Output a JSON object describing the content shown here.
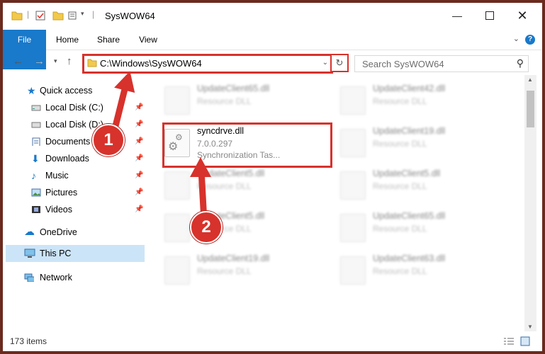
{
  "window": {
    "title": "SysWOW64"
  },
  "ribbon": {
    "tabs": [
      "File",
      "Home",
      "Share",
      "View"
    ],
    "help": "?"
  },
  "address": {
    "path": "C:\\Windows\\SysWOW64",
    "search_placeholder": "Search SysWOW64"
  },
  "nav": {
    "quick_access": "Quick access",
    "items": [
      {
        "label": "Local Disk (C:)",
        "icon": "drive-icon",
        "pinned": true
      },
      {
        "label": "Local Disk (D:)",
        "icon": "drive-icon",
        "pinned": true
      },
      {
        "label": "Documents",
        "icon": "documents-icon",
        "pinned": true
      },
      {
        "label": "Downloads",
        "icon": "download-icon",
        "pinned": true
      },
      {
        "label": "Music",
        "icon": "music-icon",
        "pinned": true
      },
      {
        "label": "Pictures",
        "icon": "pictures-icon",
        "pinned": true
      },
      {
        "label": "Videos",
        "icon": "videos-icon",
        "pinned": true
      }
    ],
    "onedrive": "OneDrive",
    "thispc": "This PC",
    "network": "Network"
  },
  "files": {
    "highlighted": {
      "name": "syncdrve.dll",
      "version": "7.0.0.297",
      "description": "Synchronization Tas..."
    },
    "left": [
      {
        "name": "UpdateClient65.dll",
        "type": "Resource DLL"
      },
      {
        "name": "UpdateClient5.dll",
        "type": "Resource DLL"
      },
      {
        "name": "UpdateClient5.dll",
        "type": "Resource DLL"
      },
      {
        "name": "UpdateClient19.dll",
        "type": "Resource DLL"
      }
    ],
    "right": [
      {
        "name": "UpdateClient42.dll",
        "type": "Resource DLL"
      },
      {
        "name": "UpdateClient19.dll",
        "type": "Resource DLL"
      },
      {
        "name": "UpdateClient5.dll",
        "type": "Resource DLL"
      },
      {
        "name": "UpdateClient65.dll",
        "type": "Resource DLL"
      },
      {
        "name": "UpdateClient63.dll",
        "type": "Resource DLL"
      }
    ]
  },
  "status": {
    "count": "173 items"
  },
  "callouts": [
    "1",
    "2"
  ],
  "colors": {
    "accent": "#1979ca",
    "highlight": "#d7322c",
    "selection": "#cce4f7"
  }
}
